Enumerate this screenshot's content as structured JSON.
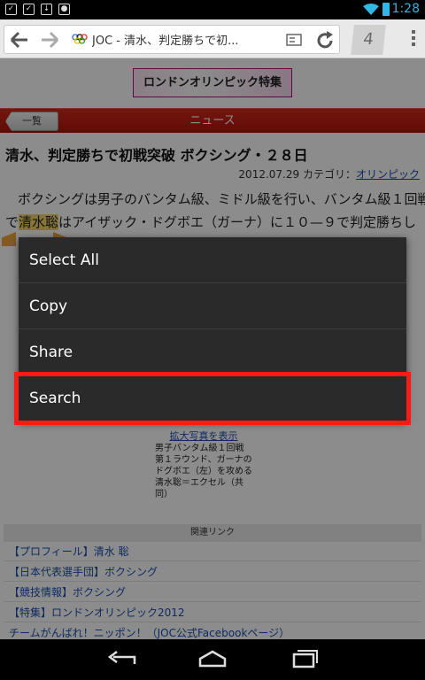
{
  "status_bar": {
    "time": "1:28",
    "notif_icons": [
      "checkbox-icon",
      "checkbox-icon",
      "download-icon",
      "robot-icon"
    ]
  },
  "browser": {
    "url_title": "JOC - 清水、判定勝ちで初...",
    "tab_count": "4"
  },
  "page": {
    "banner": "ロンドンオリンピック特集",
    "back_button": "一覧",
    "section_title": "ニュース",
    "headline": "清水、判定勝ちで初戦突破 ボクシング・２８日",
    "date": "2012.07.29",
    "category_label": "カテゴリ：",
    "category_link": "オリンピック",
    "body_line1": "ボクシングは男子のバンタム級、ミドル級を行い、バンタム級１回戦",
    "body_line2_pre": "で",
    "body_line2_sel": "清水聡",
    "body_line2_post": "はアイザック・ドグボエ（ガーナ）に１０—９で判定勝ちし",
    "photo_link": "拡大写真を表示",
    "caption": "男子バンタム級１回戦第１ラウンド、ガーナのドグボエ（左）を攻める清水聡＝エクセル（共同）",
    "related_heading": "関連リンク",
    "related_links": [
      "【プロフィール】清水 聡",
      "【日本代表選手団】ボクシング",
      "【競技情報】ボクシング",
      "【特集】ロンドンオリンピック2012",
      "チームがんばれ！ニッポン！（JOC公式Facebookページ）"
    ]
  },
  "context_menu": {
    "items": [
      "Select All",
      "Copy",
      "Share",
      "Search"
    ],
    "highlighted": "Search"
  },
  "colors": {
    "accent": "#33b5e5",
    "highlight_border": "#ff1a1a",
    "news_bar": "#c41e14"
  }
}
